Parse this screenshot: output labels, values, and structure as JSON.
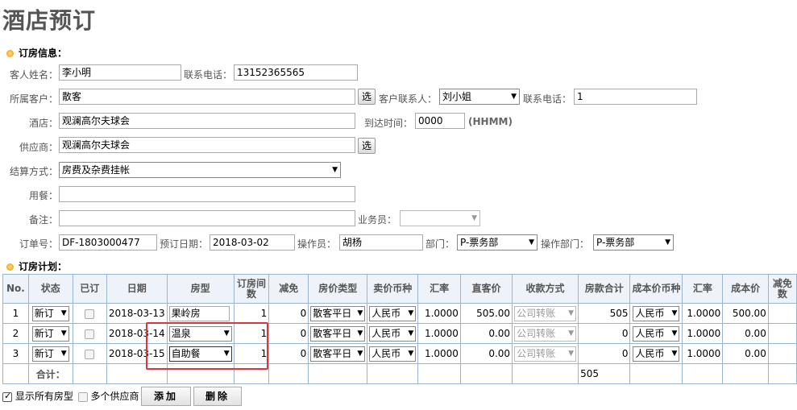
{
  "page": {
    "title": "酒店预订"
  },
  "booking_info": {
    "section_title": "订房信息：",
    "guest_name_label": "客人姓名：",
    "guest_name": "李小明",
    "phone_label": "联系电话：",
    "phone": "13152365565",
    "customer_label": "所属客户：",
    "customer": "散客",
    "select_btn": "选",
    "contact_label": "客户联系人：",
    "contact": "刘小姐",
    "contact_phone_label": "联系电话：",
    "contact_phone": "1",
    "hotel_label": "酒店：",
    "hotel": "观澜高尔夫球会",
    "arrival_label": "到达时间：",
    "arrival": "0000",
    "arrival_hint": "(HHMM)",
    "supplier_label": "供应商：",
    "supplier": "观澜高尔夫球会",
    "settlement_label": "结算方式：",
    "settlement": "房费及杂费挂帐",
    "meal_label": "用餐：",
    "meal": "",
    "remark_label": "备注：",
    "remark": "",
    "salesman_label": "业务员：",
    "salesman": "",
    "order_no_label": "订单号：",
    "order_no": "DF-1803000477",
    "order_date_label": "预订日期：",
    "order_date": "2018-03-02",
    "operator_label": "操作员：",
    "operator": "胡杨",
    "dept_label": "部门：",
    "dept": "P-票务部",
    "op_dept_label": "操作部门：",
    "op_dept": "P-票务部"
  },
  "plan": {
    "section_title": "订房计划：",
    "headers": [
      "No.",
      "状态",
      "已订",
      "日期",
      "房型",
      "订房间数",
      "减免",
      "房价类型",
      "卖价币种",
      "汇率",
      "直客价",
      "收款方式",
      "房款合计",
      "成本价币种",
      "汇率",
      "成本价",
      "减免数"
    ],
    "rows": [
      {
        "no": "1",
        "status": "新订",
        "date": "2018-03-13",
        "room_type": "果岭房",
        "rooms": "1",
        "discount": "0",
        "price_type": "散客平日",
        "currency": "人民币",
        "rate": "1.0000",
        "price": "505.00",
        "payment": "公司转账",
        "total": "505",
        "cost_currency": "人民币",
        "cost_rate": "1.0000",
        "cost": "500.00"
      },
      {
        "no": "2",
        "status": "新订",
        "date": "2018-03-14",
        "room_type": "温泉",
        "rooms": "1",
        "discount": "0",
        "price_type": "散客平日",
        "currency": "人民币",
        "rate": "1.0000",
        "price": "0.00",
        "payment": "公司转账",
        "total": "0",
        "cost_currency": "人民币",
        "cost_rate": "1.0000",
        "cost": "0.00"
      },
      {
        "no": "3",
        "status": "新订",
        "date": "2018-03-15",
        "room_type": "自助餐",
        "rooms": "1",
        "discount": "0",
        "price_type": "散客平日",
        "currency": "人民币",
        "rate": "1.0000",
        "price": "0.00",
        "payment": "公司转账",
        "total": "0",
        "cost_currency": "人民币",
        "cost_rate": "1.0000",
        "cost": "0.00"
      }
    ],
    "total_label": "合计：",
    "total_value": "505"
  },
  "bottom": {
    "show_all_label": "显示所有房型",
    "multi_supplier_label": "多个供应商",
    "add_btn": "添加",
    "delete_btn": "删除"
  },
  "colors": {
    "header_bg": "#eef3f9",
    "border": "#9bb5d0",
    "highlight": "#d9363e",
    "dot": "#f5a623"
  }
}
